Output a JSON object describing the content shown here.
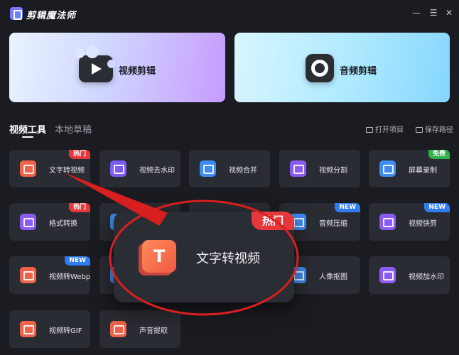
{
  "app": {
    "title": "剪辑魔法师",
    "minimize_glyph": "—",
    "menu_glyph": "☰",
    "close_glyph": "✕"
  },
  "banners": [
    {
      "label": "视频剪辑",
      "icon": "video-play-icon"
    },
    {
      "label": "音频剪辑",
      "icon": "audio-disc-icon"
    }
  ],
  "tabs": [
    {
      "label": "视频工具",
      "active": true
    },
    {
      "label": "本地草稿",
      "active": false
    }
  ],
  "toolbar": {
    "open_project": "打开项目",
    "save_path": "保存路径"
  },
  "tools": [
    {
      "label": "文字转视频",
      "icon_color": "#f0624a",
      "badge": "热门",
      "badge_color": "#e5383b"
    },
    {
      "label": "视频去水印",
      "icon_color": "#7d5cf5",
      "badge": "",
      "badge_color": ""
    },
    {
      "label": "视频合并",
      "icon_color": "#3f8cf5",
      "badge": "",
      "badge_color": ""
    },
    {
      "label": "视频分割",
      "icon_color": "#8a5cf5",
      "badge": "",
      "badge_color": ""
    },
    {
      "label": "屏幕录制",
      "icon_color": "#3f8cf5",
      "badge": "免费",
      "badge_color": "#2fb24a"
    },
    {
      "label": "格式转换",
      "icon_color": "#8a5cf5",
      "badge": "热门",
      "badge_color": "#e5383b"
    },
    {
      "label": "",
      "icon_color": "#3f8cf5",
      "badge": "",
      "badge_color": ""
    },
    {
      "label": "",
      "icon_color": "#3f8cf5",
      "badge": "",
      "badge_color": ""
    },
    {
      "label": "音频压缩",
      "icon_color": "#3f8cf5",
      "badge": "NEW",
      "badge_color": "#2f7df0"
    },
    {
      "label": "视频快剪",
      "icon_color": "#8a5cf5",
      "badge": "NEW",
      "badge_color": "#2f7df0"
    },
    {
      "label": "视频转Webp",
      "icon_color": "#f0624a",
      "badge": "NEW",
      "badge_color": "#2f7df0"
    },
    {
      "label": "",
      "icon_color": "#3f8cf5",
      "badge": "",
      "badge_color": ""
    },
    {
      "label": "",
      "icon_color": "#3f8cf5",
      "badge": "",
      "badge_color": ""
    },
    {
      "label": "人像抠图",
      "icon_color": "#3f8cf5",
      "badge": "",
      "badge_color": ""
    },
    {
      "label": "视频加水印",
      "icon_color": "#8a5cf5",
      "badge": "",
      "badge_color": ""
    },
    {
      "label": "视频转GIF",
      "icon_color": "#f0624a",
      "badge": "",
      "badge_color": ""
    },
    {
      "label": "声音提取",
      "icon_color": "#f0624a",
      "badge": "",
      "badge_color": ""
    }
  ],
  "zoom_callout": {
    "label": "文字转视频",
    "badge": "热门",
    "icon_letter": "T",
    "highlight_color": "#d81f1f"
  }
}
